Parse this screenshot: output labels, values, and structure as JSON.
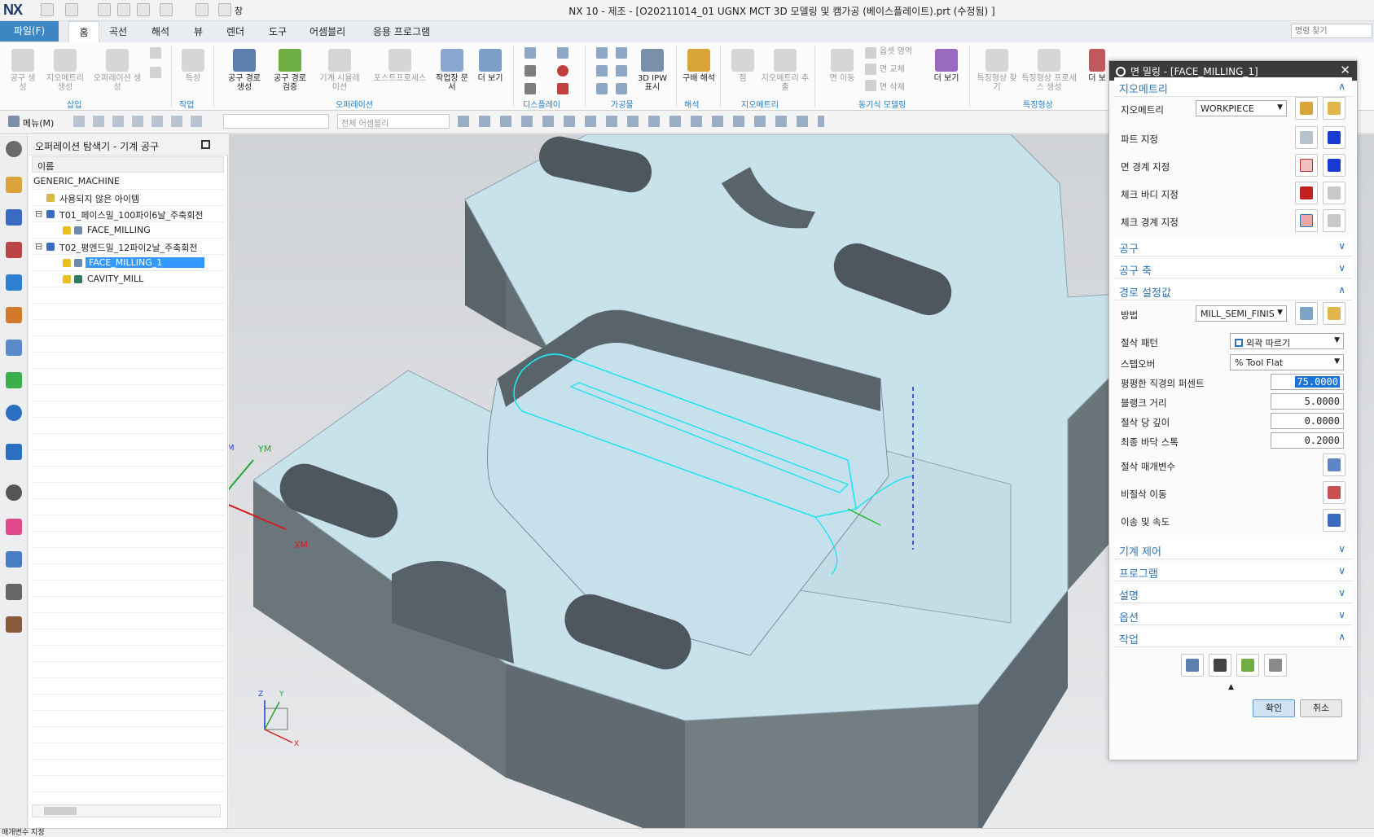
{
  "app": {
    "logo": "NX",
    "window_title": "NX 10 - 제조 - [O20211014_01 UGNX MCT 3D 모델링 및 캠가공 (베이스플레이트).prt (수정됨) ]",
    "window_menu": "창"
  },
  "menu": {
    "file": "파일(F)",
    "tabs": [
      "홈",
      "곡선",
      "해석",
      "뷰",
      "렌더",
      "도구",
      "어셈블리",
      "응용 프로그램"
    ],
    "search_placeholder": "명령 찾기"
  },
  "ribbon": {
    "buttons": [
      "공구 생성",
      "지오메트리 생성",
      "오퍼레이션 생성",
      "특성",
      "공구 경로 생성",
      "공구 경로 검증",
      "기계 시뮬레이션",
      "포스트프로세스",
      "작업장 문서",
      "더 보기",
      "3D IPW 표시",
      "구배 해석",
      "점",
      "지오메트리 추출",
      "면 이동",
      "옵셋 영역",
      "면 교체",
      "면 삭제",
      "더 보기",
      "특징형상 찾기",
      "특징형상 프로세스 생성",
      "더 보"
    ],
    "groups": [
      "삽입",
      "작업",
      "오퍼레이션",
      "디스플레이",
      "가공물",
      "해석",
      "지오메트리",
      "동기식 모델링",
      "특징형상"
    ]
  },
  "toolbar2": {
    "menu_label": "메뉴(M)",
    "filter_placeholder": "",
    "assembly_combo": "전체 어셈블리"
  },
  "navigator": {
    "title": "오퍼레이션 탐색기 - 기계 공구",
    "column_header": "이름",
    "rows": [
      "GENERIC_MACHINE",
      "사용되지 않은 아이템",
      "T01_페이스밀_100파이6날_주축회전",
      "FACE_MILLING",
      "T02_평엔드밀_12파이2날_주축회전",
      "FACE_MILLING_1",
      "CAVITY_MILL"
    ]
  },
  "viewport": {
    "axis_labels": [
      "M",
      "YM",
      "XM",
      "Z",
      "Y",
      "X"
    ]
  },
  "dialog": {
    "title": "면 밀링 - [FACE_MILLING_1]",
    "close": "✕",
    "geometry": {
      "section": "지오메트리",
      "geometry_label": "지오메트리",
      "geometry_value": "WORKPIECE",
      "part": "파트 지정",
      "face_boundary": "면 경계 지정",
      "check_body": "체크 바디 지정",
      "check_boundary": "체크 경계 지정"
    },
    "tool_section": "공구",
    "tool_axis_section": "공구 축",
    "path": {
      "section": "경로 설정값",
      "method_label": "방법",
      "method_value": "MILL_SEMI_FINIS",
      "cut_pattern_label": "절삭 패턴",
      "cut_pattern_value": "외곽 따르기",
      "stepover_label": "스텝오버",
      "stepover_value": "% Tool Flat",
      "flat_diameter_label": "평평한 직경의 퍼센트",
      "flat_diameter_value": "75.0000",
      "blank_distance_label": "블랭크 거리",
      "blank_distance_value": "5.0000",
      "depth_per_cut_label": "절삭 당 깊이",
      "depth_per_cut_value": "0.0000",
      "final_floor_label": "최종 바닥 스톡",
      "final_floor_value": "0.2000",
      "cut_params_label": "절삭 매개변수",
      "non_cut_label": "비절삭 이동",
      "feeds_label": "이송 및 속도"
    },
    "collapsed_sections": [
      "기계 제어",
      "프로그램",
      "설명",
      "옵션"
    ],
    "actions_section": "작업",
    "ok_button": "확인",
    "cancel_button": "취소"
  },
  "status": {
    "text": "매개변수 지정"
  },
  "colors": {
    "accent": "#3c86c4",
    "selection": "#3399ff",
    "part_top": "#c8e2ec",
    "part_side": "#67727a",
    "toolpath": "#22e3f0"
  }
}
